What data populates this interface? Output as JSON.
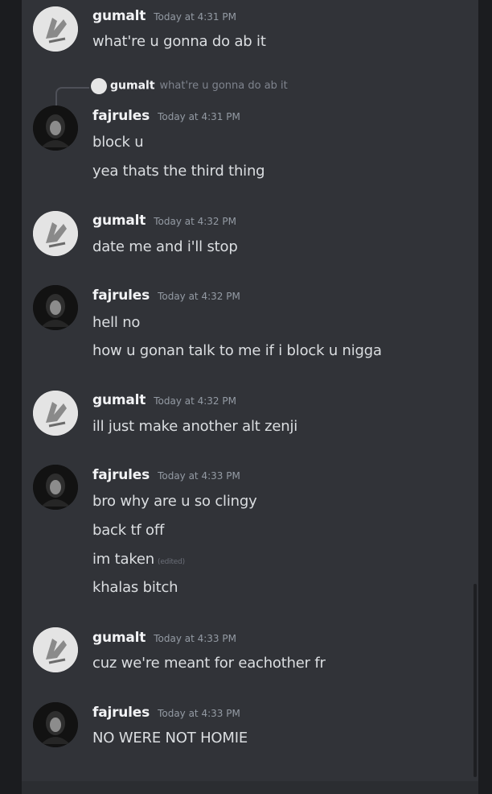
{
  "messages": [
    {
      "author": "gumalt",
      "avatar_icon": "hand-gesture-avatar-icon",
      "timestamp": "Today at 4:31 PM",
      "lines": [
        "what're u gonna do ab it"
      ]
    },
    {
      "author": "fajrules",
      "avatar_icon": "dark-hooded-avatar-icon",
      "timestamp": "Today at 4:31 PM",
      "reply": {
        "author": "gumalt",
        "text": "what're u gonna do ab it"
      },
      "lines": [
        "block u",
        "yea thats the third thing"
      ]
    },
    {
      "author": "gumalt",
      "avatar_icon": "hand-gesture-avatar-icon",
      "timestamp": "Today at 4:32 PM",
      "lines": [
        "date me and i'll stop"
      ]
    },
    {
      "author": "fajrules",
      "avatar_icon": "dark-hooded-avatar-icon",
      "timestamp": "Today at 4:32 PM",
      "lines": [
        "hell no",
        "how u gonan talk to me if i block u nigga"
      ]
    },
    {
      "author": "gumalt",
      "avatar_icon": "hand-gesture-avatar-icon",
      "timestamp": "Today at 4:32 PM",
      "lines": [
        "ill just make another alt zenji"
      ]
    },
    {
      "author": "fajrules",
      "avatar_icon": "dark-hooded-avatar-icon",
      "timestamp": "Today at 4:33 PM",
      "lines": [
        "bro why are u so clingy",
        "back tf off",
        "im taken",
        "khalas bitch"
      ],
      "edited_label": "(edited)"
    },
    {
      "author": "gumalt",
      "avatar_icon": "hand-gesture-avatar-icon",
      "timestamp": "Today at 4:33 PM",
      "lines": [
        "cuz we're meant for eachother fr"
      ]
    },
    {
      "author": "fajrules",
      "avatar_icon": "dark-hooded-avatar-icon",
      "timestamp": "Today at 4:33 PM",
      "lines": [
        "NO WERE NOT HOMIE"
      ]
    }
  ],
  "colors": {
    "background": "#313338",
    "username": "#f2f3f5",
    "message_text": "#dbdee1",
    "timestamp": "#949ba4"
  }
}
